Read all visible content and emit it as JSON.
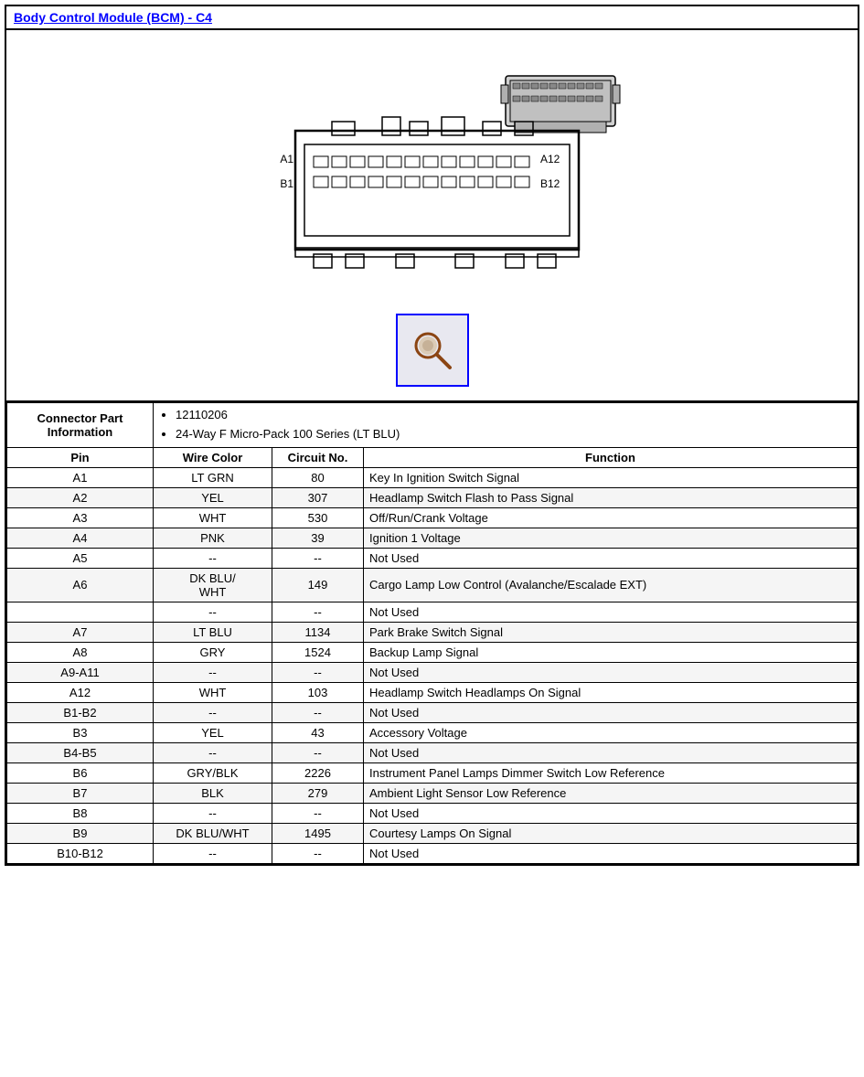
{
  "title": "Body Control Module (BCM) - C4",
  "connectorInfo": {
    "label": "Connector Part Information",
    "partNumbers": [
      "12110206",
      "24-Way F Micro-Pack 100 Series (LT BLU)"
    ]
  },
  "tableHeaders": {
    "pin": "Pin",
    "wireColor": "Wire Color",
    "circuitNo": "Circuit No.",
    "function": "Function"
  },
  "rows": [
    {
      "pin": "A1",
      "wireColor": "LT GRN",
      "circuitNo": "80",
      "function": "Key In Ignition Switch Signal"
    },
    {
      "pin": "A2",
      "wireColor": "YEL",
      "circuitNo": "307",
      "function": "Headlamp Switch Flash to Pass Signal"
    },
    {
      "pin": "A3",
      "wireColor": "WHT",
      "circuitNo": "530",
      "function": "Off/Run/Crank Voltage"
    },
    {
      "pin": "A4",
      "wireColor": "PNK",
      "circuitNo": "39",
      "function": "Ignition 1 Voltage"
    },
    {
      "pin": "A5",
      "wireColor": "--",
      "circuitNo": "--",
      "function": "Not Used"
    },
    {
      "pin": "A6",
      "wireColor": "DK BLU/\nWHT",
      "circuitNo": "149",
      "function": "Cargo Lamp Low Control (Avalanche/Escalade EXT)"
    },
    {
      "pin": "",
      "wireColor": "--",
      "circuitNo": "--",
      "function": "Not Used"
    },
    {
      "pin": "A7",
      "wireColor": "LT BLU",
      "circuitNo": "1134",
      "function": "Park Brake Switch Signal"
    },
    {
      "pin": "A8",
      "wireColor": "GRY",
      "circuitNo": "1524",
      "function": "Backup Lamp Signal"
    },
    {
      "pin": "A9-A11",
      "wireColor": "--",
      "circuitNo": "--",
      "function": "Not Used"
    },
    {
      "pin": "A12",
      "wireColor": "WHT",
      "circuitNo": "103",
      "function": "Headlamp Switch Headlamps On Signal"
    },
    {
      "pin": "B1-B2",
      "wireColor": "--",
      "circuitNo": "--",
      "function": "Not Used"
    },
    {
      "pin": "B3",
      "wireColor": "YEL",
      "circuitNo": "43",
      "function": "Accessory Voltage"
    },
    {
      "pin": "B4-B5",
      "wireColor": "--",
      "circuitNo": "--",
      "function": "Not Used"
    },
    {
      "pin": "B6",
      "wireColor": "GRY/BLK",
      "circuitNo": "2226",
      "function": "Instrument Panel Lamps Dimmer Switch Low Reference"
    },
    {
      "pin": "B7",
      "wireColor": "BLK",
      "circuitNo": "279",
      "function": "Ambient Light Sensor Low Reference"
    },
    {
      "pin": "B8",
      "wireColor": "--",
      "circuitNo": "--",
      "function": "Not Used"
    },
    {
      "pin": "B9",
      "wireColor": "DK BLU/WHT",
      "circuitNo": "1495",
      "function": "Courtesy Lamps On Signal"
    },
    {
      "pin": "B10-B12",
      "wireColor": "--",
      "circuitNo": "--",
      "function": "Not Used"
    }
  ]
}
